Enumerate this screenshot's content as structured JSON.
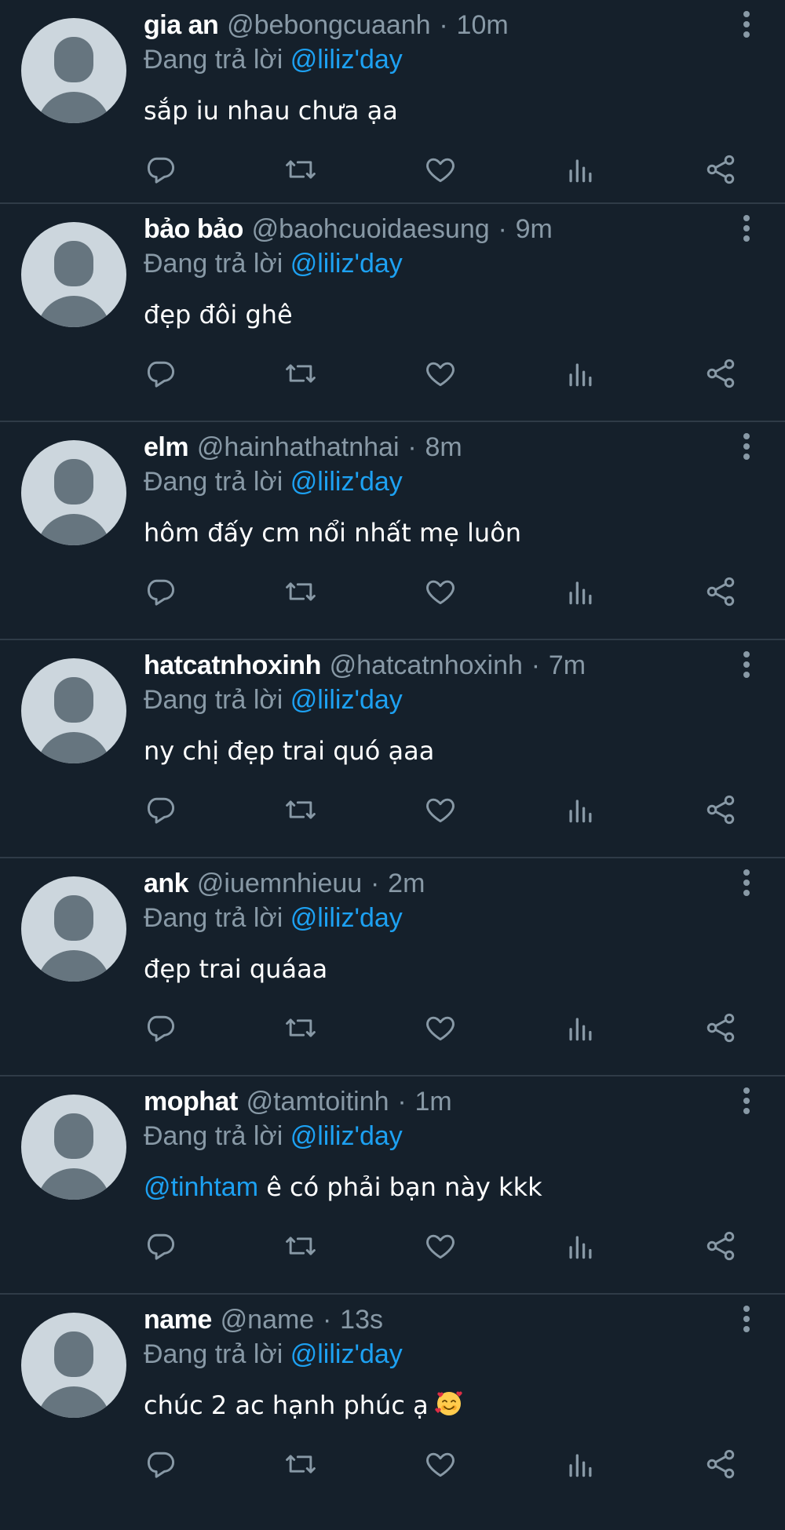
{
  "tweets": [
    {
      "name": "gia an",
      "handle": "@bebongcuaanh",
      "time": "10m",
      "reply_prefix": "Đang trả lời",
      "reply_to": "@liliz'day",
      "text": "sắp iu nhau chưa ạa"
    },
    {
      "name": "bảo bảo",
      "handle": "@baohcuoidaesung",
      "time": "9m",
      "reply_prefix": "Đang trả lời",
      "reply_to": "@liliz'day",
      "text": "đẹp đôi ghê"
    },
    {
      "name": "elm",
      "handle": "@hainhathatnhai",
      "time": "8m",
      "reply_prefix": "Đang trả lời",
      "reply_to": "@liliz'day",
      "text": "hôm đấy cm nổi nhất mẹ luôn"
    },
    {
      "name": "hatcatnhoxinh",
      "handle": "@hatcatnhoxinh",
      "time": "7m",
      "reply_prefix": "Đang trả lời",
      "reply_to": "@liliz'day",
      "text": "ny chị đẹp trai quó ạaa"
    },
    {
      "name": "ank",
      "handle": "@iuemnhieuu",
      "time": "2m",
      "reply_prefix": "Đang trả lời",
      "reply_to": "@liliz'day",
      "text": "đẹp trai quáaa"
    },
    {
      "name": "mophat",
      "handle": "@tamtoitinh",
      "time": "1m",
      "reply_prefix": "Đang trả lời",
      "reply_to": "@liliz'day",
      "text_mention": "@tinhtam",
      "text": "ê có phải bạn này kkk"
    },
    {
      "name": "name",
      "handle": "@name",
      "time": "13s",
      "reply_prefix": "Đang trả lời",
      "reply_to": "@liliz'day",
      "text": "chúc 2 ac hạnh phúc ạ",
      "emoji": "smiling-face-with-hearts"
    }
  ],
  "separator": "·",
  "icons": {
    "reply": "reply-icon",
    "retweet": "retweet-icon",
    "like": "heart-icon",
    "stats": "analytics-icon",
    "share": "share-icon",
    "more": "more-icon"
  },
  "colors": {
    "background": "#15202b",
    "divider": "#2f3b47",
    "secondary_text": "#8899a6",
    "link": "#1da1f2",
    "avatar_bg": "#ccd6dd",
    "avatar_fg": "#66757f"
  }
}
